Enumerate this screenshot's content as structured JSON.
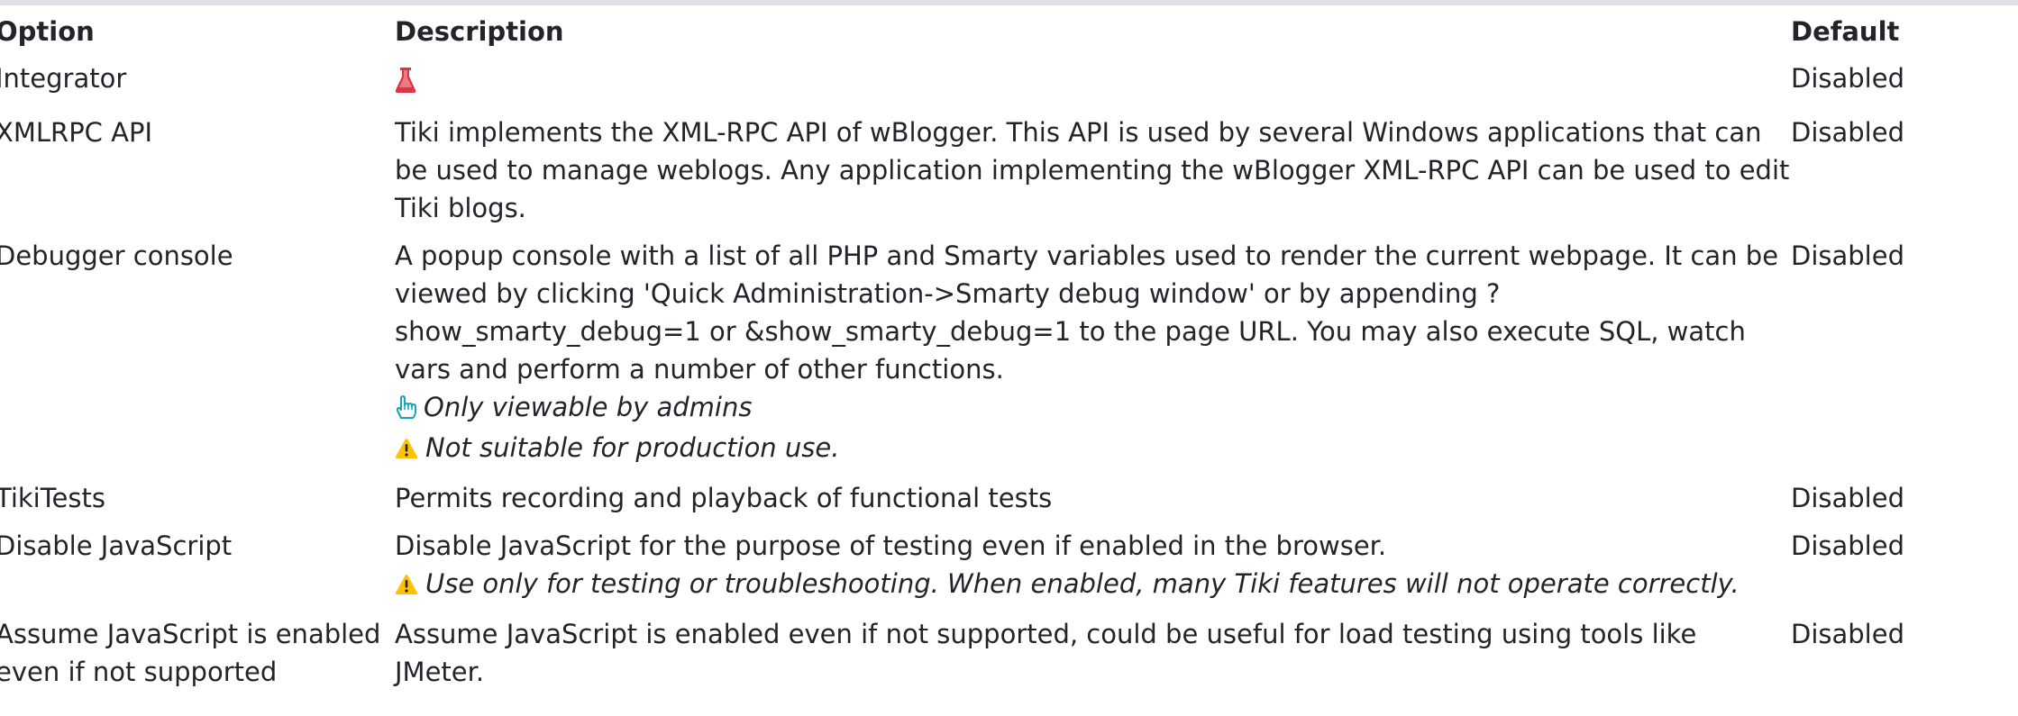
{
  "headers": {
    "option": "Option",
    "description": "Description",
    "default": "Default"
  },
  "rows": [
    {
      "option": "Integrator",
      "description": "",
      "default": "Disabled",
      "icon": "flask-icon"
    },
    {
      "option": "XMLRPC API",
      "description": "Tiki implements the XML-RPC API of wBlogger. This API is used by several Windows applications that can be used to manage weblogs. Any application implementing the wBlogger XML-RPC API can be used to edit Tiki blogs.",
      "default": "Disabled"
    },
    {
      "option": "Debugger console",
      "description": "A popup console with a list of all PHP and Smarty variables used to render the current webpage. It can be viewed by clicking 'Quick Administration->Smarty debug window' or by appending ?show_smarty_debug=1 or &show_smarty_debug=1 to the page URL. You may also execute SQL, watch vars and perform a number of other functions.",
      "default": "Disabled",
      "notes": [
        {
          "icon": "hand-pointer-icon",
          "text": "Only viewable by admins"
        },
        {
          "icon": "warning-icon",
          "text": "Not suitable for production use."
        }
      ]
    },
    {
      "option": "TikiTests",
      "description": "Permits recording and playback of functional tests",
      "default": "Disabled"
    },
    {
      "option": "Disable JavaScript",
      "description": "Disable JavaScript for the purpose of testing even if enabled in the browser.",
      "default": "Disabled",
      "notes": [
        {
          "icon": "warning-icon",
          "text": "Use only for testing or troubleshooting. When enabled, many Tiki features will not operate correctly."
        }
      ]
    },
    {
      "option": "Assume JavaScript is enabled even if not supported",
      "description": "Assume JavaScript is enabled even if not supported, could be useful for load testing using tools like JMeter.",
      "default": "Disabled"
    }
  ],
  "colors": {
    "text": "#212529",
    "rule": "#dee2e6",
    "flask": "#dc3545",
    "info": "#17a2b8",
    "warning": "#ffc107"
  }
}
